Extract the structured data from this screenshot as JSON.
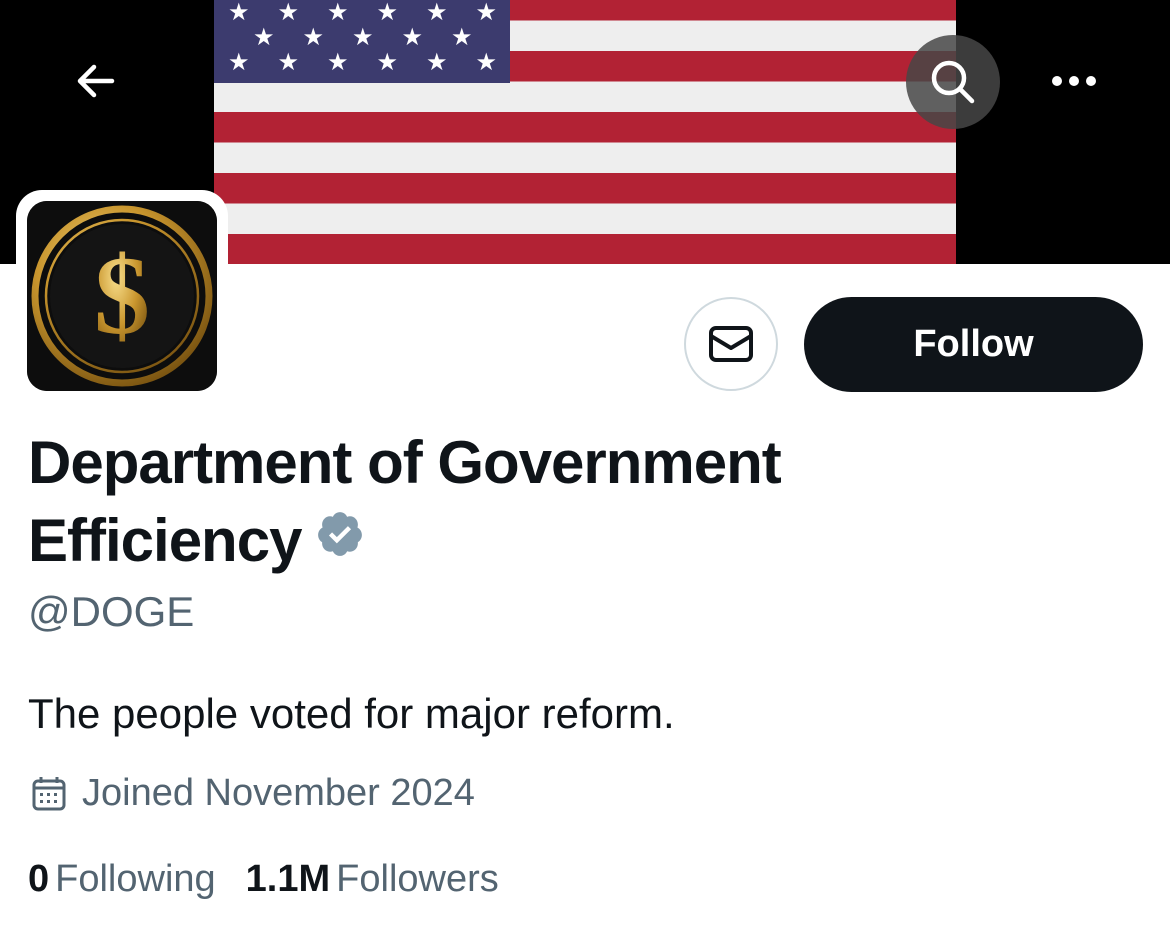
{
  "header": {
    "back_icon": "arrow-left-icon",
    "search_icon": "search-icon",
    "more_icon": "more-horizontal-icon"
  },
  "banner": {
    "description_icon": "us-flag-banner"
  },
  "profile": {
    "avatar_icon": "gold-dollar-coin-avatar",
    "message_icon": "envelope-icon",
    "follow_label": "Follow",
    "display_name": "Department of Government Efficiency",
    "verified_icon": "verified-badge-icon",
    "handle": "@DOGE",
    "bio": "The people voted for major reform.",
    "joined": "Joined November 2024",
    "stats": {
      "following_count": "0",
      "following_label": "Following",
      "followers_count": "1.1M",
      "followers_label": "Followers"
    }
  },
  "colors": {
    "text_primary": "#0f1419",
    "text_secondary": "#536471",
    "follow_bg": "#0f1419",
    "badge": "#829aab",
    "flag_red": "#b22234",
    "flag_blue": "#3c3b6e"
  }
}
